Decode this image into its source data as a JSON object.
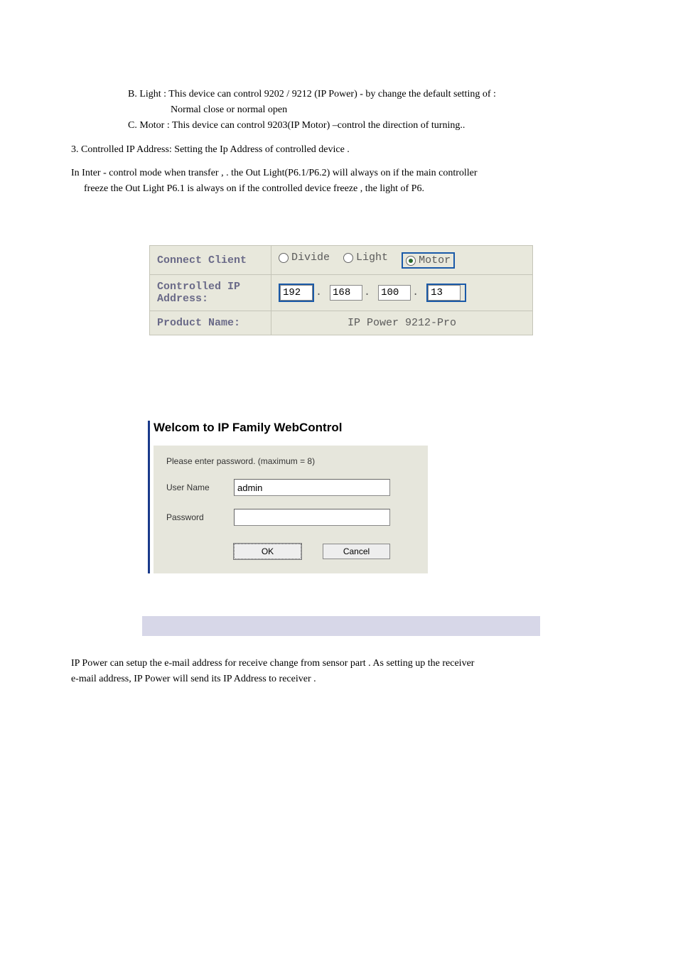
{
  "text": {
    "lineB": "B. Light :   This device can control  9202 / 9212 (IP Power)  -  by  change the default setting of  :",
    "lineB2": "Normal close or normal  open",
    "lineC": "C. Motor :  This device  can control 9203(IP Motor) –control the direction of turning..",
    "line3": "3. Controlled IP Address:  Setting the Ip Address of controlled device .",
    "lineInter1": "In Inter - control mode when transfer , .  the  Out Light(P6.1/P6.2) will always on    if the main controller",
    "lineInter2": "freeze  the Out Light P6.1 is always on    if the controlled  device  freeze , the light of  P6.",
    "finalPara1": "IP Power can setup the e-mail address for receive change from sensor part .   As setting up the  receiver",
    "finalPara2": "e-mail address,  IP Power will send  its  IP Address  to receiver ."
  },
  "connect": {
    "labels": {
      "client": "Connect Client",
      "address": "Controlled IP Address:",
      "product": "Product Name:"
    },
    "radios": {
      "divide": "Divide",
      "light": "Light",
      "motor": "Motor"
    },
    "ip": {
      "o1": "192",
      "o2": "168",
      "o3": "100",
      "o4": "13"
    },
    "product": "IP Power 9212-Pro"
  },
  "login": {
    "title": "Welcom to IP Family WebControl",
    "prompt": "Please enter password. (maximum = 8)",
    "userLabel": "User Name",
    "userValue": "admin",
    "passLabel": "Password",
    "passValue": "",
    "ok": "OK",
    "cancel": "Cancel"
  }
}
